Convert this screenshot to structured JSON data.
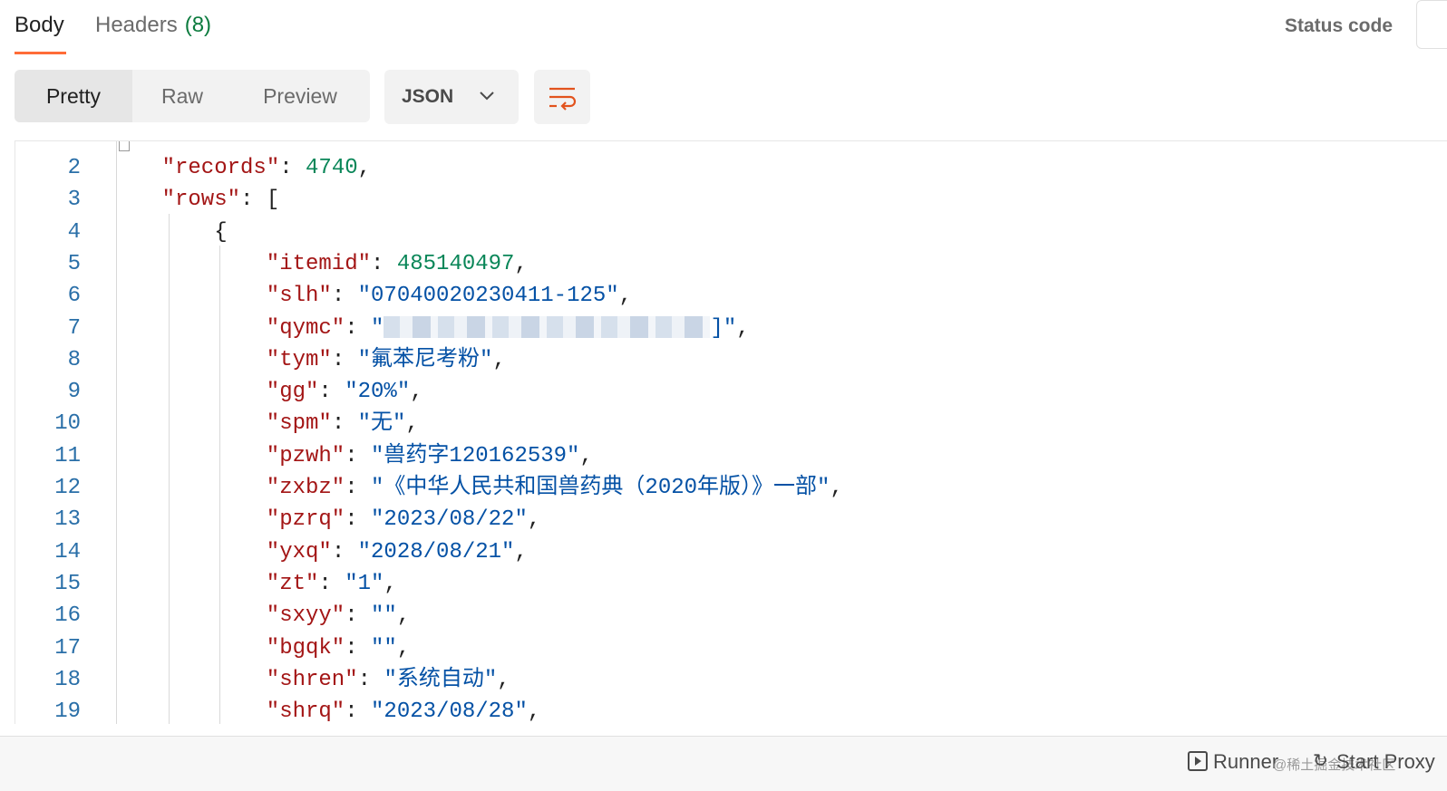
{
  "tabs": {
    "body_label": "Body",
    "headers_label": "Headers",
    "headers_count": "(8)",
    "status_code_label": "Status code"
  },
  "toolbar": {
    "pretty": "Pretty",
    "raw": "Raw",
    "preview": "Preview",
    "format_selected": "JSON"
  },
  "editor": {
    "lines": [
      {
        "num": "2",
        "indent": 2,
        "key": "\"records\"",
        "value": "4740",
        "vtype": "n",
        "tail": ","
      },
      {
        "num": "3",
        "indent": 2,
        "key": "\"rows\"",
        "value": "[",
        "vtype": "p",
        "tail": ""
      },
      {
        "num": "4",
        "indent": 4,
        "key": "",
        "value": "{",
        "vtype": "p",
        "tail": ""
      },
      {
        "num": "5",
        "indent": 6,
        "key": "\"itemid\"",
        "value": "485140497",
        "vtype": "n",
        "tail": ","
      },
      {
        "num": "6",
        "indent": 6,
        "key": "\"slh\"",
        "value": "\"07040020230411-125\"",
        "vtype": "s",
        "tail": ","
      },
      {
        "num": "7",
        "indent": 6,
        "key": "\"qymc\"",
        "value": "\"",
        "vtype": "s",
        "tail": "]\",",
        "blurred": true
      },
      {
        "num": "8",
        "indent": 6,
        "key": "\"tym\"",
        "value": "\"氟苯尼考粉\"",
        "vtype": "s",
        "tail": ","
      },
      {
        "num": "9",
        "indent": 6,
        "key": "\"gg\"",
        "value": "\"20%\"",
        "vtype": "s",
        "tail": ","
      },
      {
        "num": "10",
        "indent": 6,
        "key": "\"spm\"",
        "value": "\"无\"",
        "vtype": "s",
        "tail": ","
      },
      {
        "num": "11",
        "indent": 6,
        "key": "\"pzwh\"",
        "value": "\"兽药字120162539\"",
        "vtype": "s",
        "tail": ","
      },
      {
        "num": "12",
        "indent": 6,
        "key": "\"zxbz\"",
        "value": "\"《中华人民共和国兽药典（2020年版）》一部\"",
        "vtype": "s",
        "tail": ","
      },
      {
        "num": "13",
        "indent": 6,
        "key": "\"pzrq\"",
        "value": "\"2023/08/22\"",
        "vtype": "s",
        "tail": ","
      },
      {
        "num": "14",
        "indent": 6,
        "key": "\"yxq\"",
        "value": "\"2028/08/21\"",
        "vtype": "s",
        "tail": ","
      },
      {
        "num": "15",
        "indent": 6,
        "key": "\"zt\"",
        "value": "\"1\"",
        "vtype": "s",
        "tail": ","
      },
      {
        "num": "16",
        "indent": 6,
        "key": "\"sxyy\"",
        "value": "\"\"",
        "vtype": "s",
        "tail": ","
      },
      {
        "num": "17",
        "indent": 6,
        "key": "\"bgqk\"",
        "value": "\"\"",
        "vtype": "s",
        "tail": ","
      },
      {
        "num": "18",
        "indent": 6,
        "key": "\"shren\"",
        "value": "\"系统自动\"",
        "vtype": "s",
        "tail": ","
      },
      {
        "num": "19",
        "indent": 6,
        "key": "\"shrq\"",
        "value": "\"2023/08/28\"",
        "vtype": "s",
        "tail": ","
      }
    ]
  },
  "statusbar": {
    "runner": "Runner",
    "start_proxy": "Start Proxy",
    "watermark": "@稀土掘金技术社区"
  },
  "colors": {
    "accent": "#ff6c37",
    "key": "#a31515",
    "number": "#098658",
    "string": "#0451a5",
    "line_number": "#2a6fa8"
  },
  "icons": [
    "chevron-down-icon",
    "wrap-lines-icon",
    "runner-icon",
    "proxy-icon"
  ]
}
